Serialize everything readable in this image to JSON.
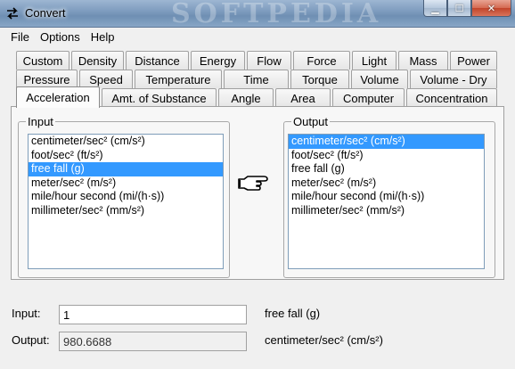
{
  "window": {
    "title": "Convert",
    "watermark": "SOFTPEDIA",
    "controls": {
      "minimize": "▁",
      "maximize": "☐",
      "close": "✕"
    }
  },
  "menu": [
    "File",
    "Options",
    "Help"
  ],
  "tabs": {
    "row1": [
      "Custom",
      "Density",
      "Distance",
      "Energy",
      "Flow",
      "Force",
      "Light",
      "Mass",
      "Power"
    ],
    "row2": [
      "Pressure",
      "Speed",
      "Temperature",
      "Time",
      "Torque",
      "Volume",
      "Volume - Dry"
    ],
    "row3": [
      "Acceleration",
      "Amt. of Substance",
      "Angle",
      "Area",
      "Computer",
      "Concentration"
    ],
    "active": "Acceleration"
  },
  "input_group": {
    "label": "Input",
    "items": [
      "centimeter/sec² (cm/s²)",
      "foot/sec² (ft/s²)",
      "free fall (g)",
      "meter/sec² (m/s²)",
      "mile/hour second (mi/(h·s))",
      "millimeter/sec² (mm/s²)"
    ],
    "selected_index": 2
  },
  "output_group": {
    "label": "Output",
    "items": [
      "centimeter/sec² (cm/s²)",
      "foot/sec² (ft/s²)",
      "free fall (g)",
      "meter/sec² (m/s²)",
      "mile/hour second (mi/(h·s))",
      "millimeter/sec² (mm/s²)"
    ],
    "selected_index": 0
  },
  "convert_icon": "pointing-hand-icon",
  "fields": {
    "input_label": "Input:",
    "input_value": "1",
    "input_unit": "free fall (g)",
    "output_label": "Output:",
    "output_value": "980.6688",
    "output_unit": "centimeter/sec² (cm/s²)"
  },
  "colors": {
    "selection": "#3399ff",
    "titlebar": "#7f9dbf"
  }
}
